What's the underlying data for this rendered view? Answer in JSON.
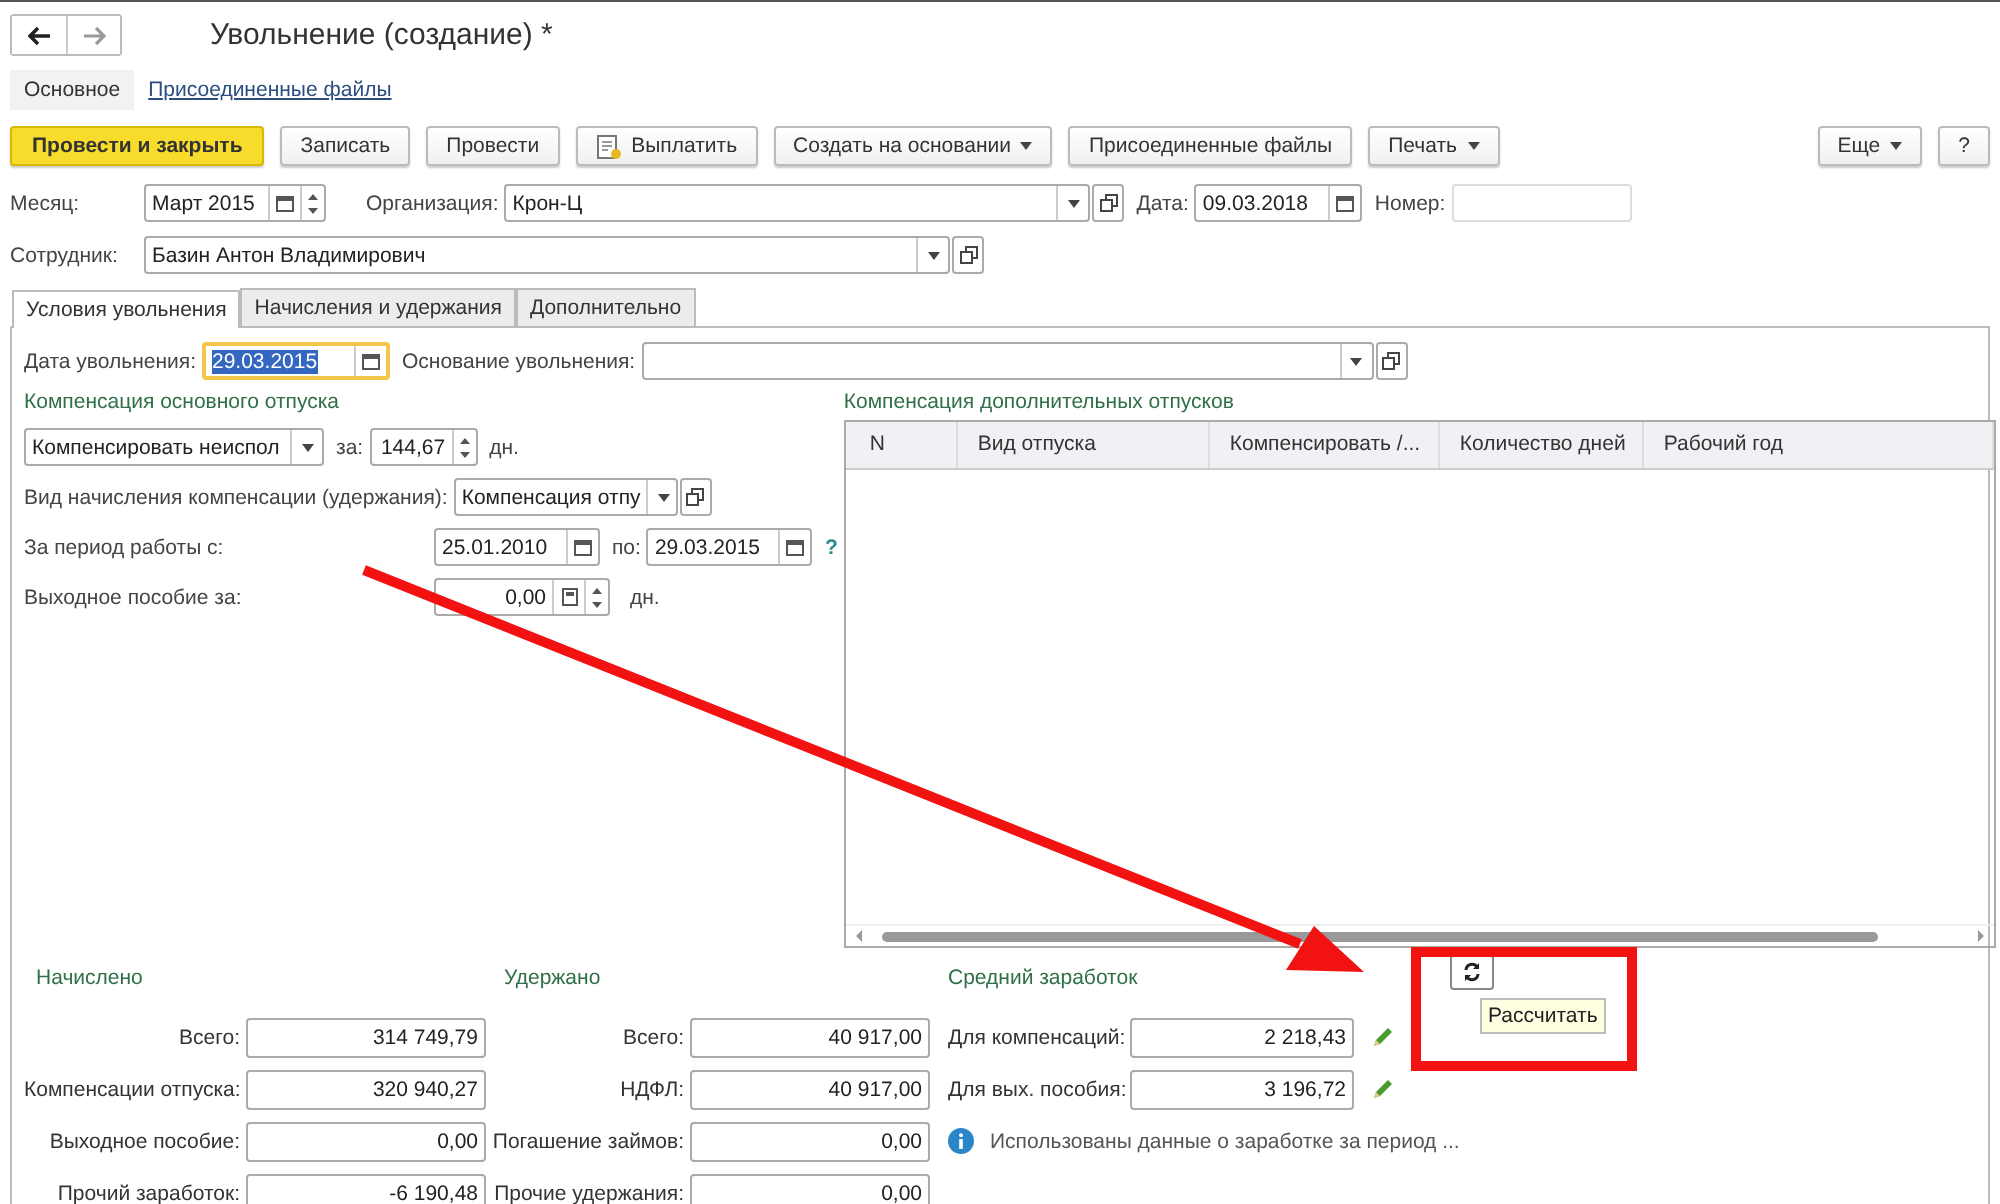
{
  "title": "Увольнение (создание) *",
  "form_tabs": [
    {
      "label": "Основное",
      "selected": true
    },
    {
      "label": "Присоединенные файлы",
      "selected": false
    }
  ],
  "toolbar": [
    {
      "label": "Провести и закрыть",
      "kind": "primary"
    },
    {
      "label": "Записать",
      "kind": "plain"
    },
    {
      "label": "Провести",
      "kind": "plain"
    },
    {
      "label": "Выплатить",
      "kind": "pay"
    },
    {
      "label": "Создать на основании",
      "kind": "menu"
    },
    {
      "label": "Присоединенные файлы",
      "kind": "plain"
    },
    {
      "label": "Печать",
      "kind": "menu"
    }
  ],
  "toolbar_right": [
    {
      "label": "Еще",
      "kind": "menu"
    },
    {
      "label": "?",
      "kind": "plain"
    }
  ],
  "month": {
    "label": "Месяц:",
    "value": "Март 2015"
  },
  "organization": {
    "label": "Организация:",
    "value": "Крон-Ц"
  },
  "date": {
    "label": "Дата:",
    "value": "09.03.2018"
  },
  "number": {
    "label": "Номер:"
  },
  "employee": {
    "label": "Сотрудник:",
    "value": "Базин Антон Владимирович"
  },
  "tabs": [
    {
      "label": "Условия увольнения",
      "selected": true
    },
    {
      "label": "Начисления и удержания",
      "selected": false
    },
    {
      "label": "Дополнительно",
      "selected": false
    }
  ],
  "dismissal_date": {
    "label": "Дата увольнения:",
    "value": "29.03.2015",
    "focused": true
  },
  "dismissal_reason": {
    "label": "Основание увольнения:"
  },
  "main_leave": {
    "title": "Компенсация основного отпуска",
    "mode": "Компенсировать неиспол",
    "for_label": "за:",
    "days": "144,67",
    "days_unit": "дн.",
    "accrual_label": "Вид начисления компенсации (удержания):",
    "accrual": "Компенсация отпу",
    "period_label": "За период работы с:",
    "period_from": "25.01.2010",
    "to_label": "по:",
    "period_to": "29.03.2015",
    "help": "?",
    "severance_label": "Выходное пособие за:",
    "severance": "0,00",
    "severance_unit": "дн."
  },
  "extra_leave": {
    "title": "Компенсация дополнительных отпусков",
    "columns": [
      "N",
      "Вид отпуска",
      "Компенсировать /...",
      "Количество дней",
      "Рабочий год"
    ]
  },
  "accrued": {
    "title": "Начислено",
    "rows": [
      {
        "label": "Всего:",
        "value": "314 749,79"
      },
      {
        "label": "Компенсации отпуска:",
        "value": "320 940,27"
      },
      {
        "label": "Выходное пособие:",
        "value": "0,00"
      },
      {
        "label": "Прочий заработок:",
        "value": "-6 190,48"
      }
    ]
  },
  "withheld": {
    "title": "Удержано",
    "rows": [
      {
        "label": "Всего:",
        "value": "40 917,00"
      },
      {
        "label": "НДФЛ:",
        "value": "40 917,00"
      },
      {
        "label": "Погашение займов:",
        "value": "0,00"
      },
      {
        "label": "Прочие удержания:",
        "value": "0,00"
      }
    ]
  },
  "average": {
    "title": "Средний заработок",
    "rows": [
      {
        "label": "Для компенсаций:",
        "value": "2 218,43"
      },
      {
        "label": "Для вых. пособия:",
        "value": "3 196,72"
      }
    ],
    "note": "Использованы данные о заработке за период ..."
  },
  "tooltip": "Рассчитать"
}
